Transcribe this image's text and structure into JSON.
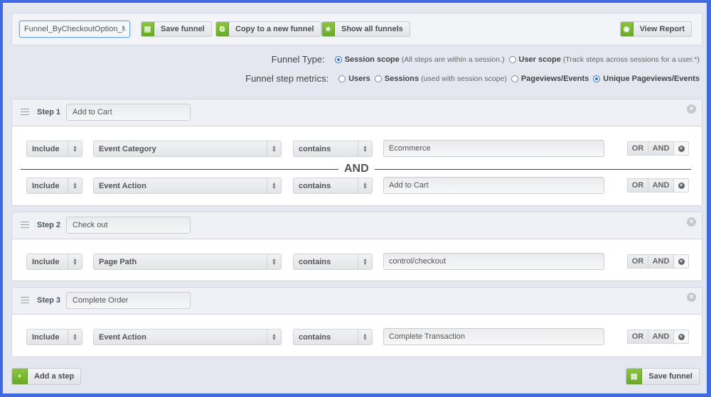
{
  "toolbar": {
    "funnel_name": "Funnel_ByCheckoutOption_Ma",
    "save_label": "Save funnel",
    "copy_label": "Copy to a new funnel",
    "show_all_label": "Show all funnels",
    "view_report_label": "View Report"
  },
  "funnel_type": {
    "label": "Funnel Type:",
    "options": [
      {
        "label": "Session scope",
        "note": "(All steps are within a session.)",
        "selected": true
      },
      {
        "label": "User scope",
        "note": "(Track steps across sessions for a user.*)",
        "selected": false
      }
    ]
  },
  "metrics": {
    "label": "Funnel step metrics:",
    "options": [
      {
        "label": "Users",
        "note": "",
        "selected": false
      },
      {
        "label": "Sessions",
        "note": "(used with session scope)",
        "selected": false
      },
      {
        "label": "Pageviews/Events",
        "note": "",
        "selected": false
      },
      {
        "label": "Unique Pageviews/Events",
        "note": "",
        "selected": true
      }
    ]
  },
  "and_separator": "AND",
  "logic": {
    "or": "OR",
    "and": "AND"
  },
  "steps": [
    {
      "label": "Step 1",
      "name": "Add to Cart",
      "conditions": [
        {
          "mode": "Include",
          "dimension": "Event Category",
          "operator": "contains",
          "value": "Ecommerce"
        },
        {
          "mode": "Include",
          "dimension": "Event Action",
          "operator": "contains",
          "value": "Add to Cart"
        }
      ]
    },
    {
      "label": "Step 2",
      "name": "Check out",
      "conditions": [
        {
          "mode": "Include",
          "dimension": "Page Path",
          "operator": "contains",
          "value": "control/checkout"
        }
      ]
    },
    {
      "label": "Step 3",
      "name": "Complete Order",
      "conditions": [
        {
          "mode": "Include",
          "dimension": "Event Action",
          "operator": "contains",
          "value": "Complete Transaction"
        }
      ]
    }
  ],
  "footer": {
    "add_step_label": "Add a step",
    "save_label": "Save funnel"
  }
}
